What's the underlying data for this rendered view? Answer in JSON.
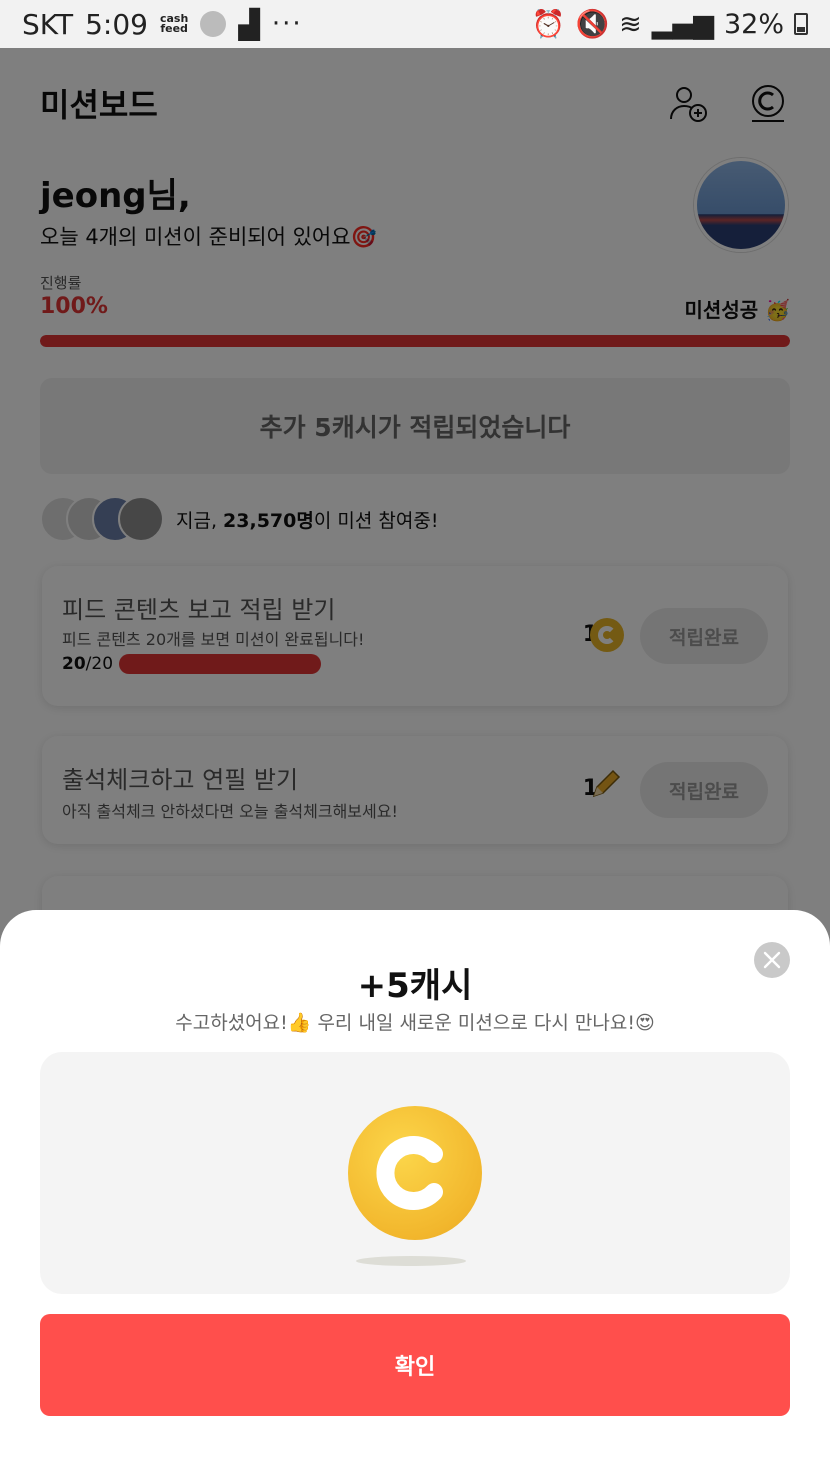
{
  "statusbar": {
    "carrier": "SKT",
    "time": "5:09",
    "cashfeed_line1": "cash",
    "cashfeed_line2": "feed",
    "dots": "···",
    "battery": "32%",
    "icons": [
      "alarm-icon",
      "mute-icon",
      "wifi-icon",
      "signal-icon",
      "battery-icon"
    ]
  },
  "header": {
    "title": "미션보드",
    "icons": [
      "add-friend-icon",
      "cash-icon"
    ]
  },
  "greeting": {
    "name": "jeong님,",
    "subtitle": "오늘 4개의 미션이 준비되어 있어요🎯"
  },
  "progress": {
    "label": "진행률",
    "percent": "100%",
    "value": 1.0,
    "status": "미션성공 🥳"
  },
  "banner": {
    "text": "추가 5캐시가 적립되었습니다"
  },
  "participants": {
    "prefix": "지금, ",
    "count": "23,570명",
    "suffix": "이 미션 참여중!"
  },
  "missions": [
    {
      "title": "피드 콘텐츠 보고 적립 받기",
      "desc": "피드 콘텐츠 20개를 보면 미션이 완료됩니다!",
      "progress_done": "20",
      "progress_total": "/20",
      "reward": "1",
      "reward_icon": "coin-icon",
      "button": "적립완료"
    },
    {
      "title": "출석체크하고 연필 받기",
      "desc": "아직 출석체크 안하셨다면 오늘 출석체크해보세요!",
      "reward": "1",
      "reward_icon": "pencil-icon",
      "button": "적립완료"
    }
  ],
  "sheet": {
    "title": "+5캐시",
    "subtitle": "수고하셨어요!👍 우리 내일 새로운 미션으로 다시 만나요!😍",
    "confirm": "확인",
    "close_icon": "close-icon",
    "coin_icon": "coin-icon"
  },
  "colors": {
    "accent": "#e03535",
    "confirm": "#ff4f4c",
    "coin": "#f2b72d"
  }
}
